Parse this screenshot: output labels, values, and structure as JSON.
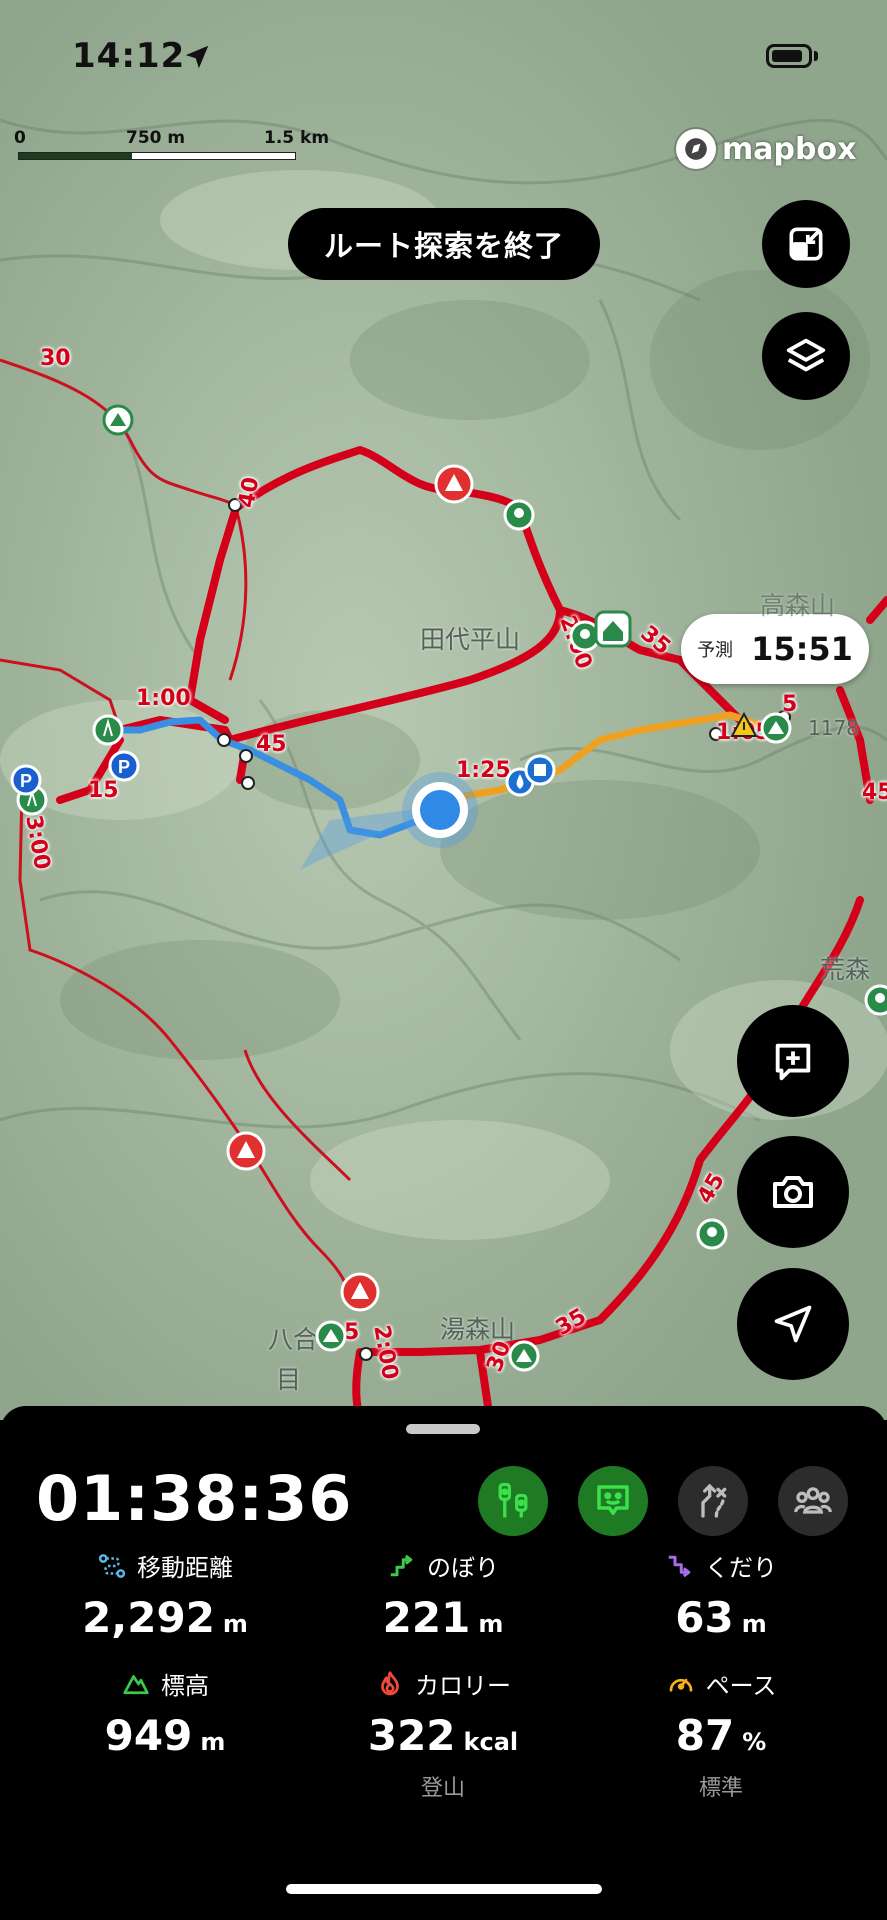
{
  "status_bar": {
    "time": "14:12"
  },
  "map": {
    "scale": {
      "zero": "0",
      "mid": "750 m",
      "max": "1.5 km"
    },
    "attribution": "mapbox",
    "end_route_search_label": "ルート探索を終了",
    "eta": {
      "label": "予測",
      "time": "15:51"
    },
    "place_names": {
      "tashiro": "田代平山",
      "yumori": "湯森山",
      "hachigo_top": "八合",
      "hachigo_bottom": "目",
      "aramori": "荒森",
      "shirouma": "高森山"
    },
    "elevation_label": "1178",
    "route_labels": [
      "30",
      "40",
      "1:00",
      "45",
      "15",
      "3:00",
      "1:25",
      "2:00",
      "35",
      "1:05",
      "5",
      "45",
      "45",
      "35",
      "30",
      "2:00",
      "5"
    ]
  },
  "panel": {
    "elapsed_time": "01:38:36",
    "stats": {
      "distance": {
        "label": "移動距離",
        "value": "2,292",
        "unit": "m"
      },
      "ascent": {
        "label": "のぼり",
        "value": "221",
        "unit": "m"
      },
      "descent": {
        "label": "くだり",
        "value": "63",
        "unit": "m"
      },
      "elevation": {
        "label": "標高",
        "value": "949",
        "unit": "m"
      },
      "calories": {
        "label": "カロリー",
        "value": "322",
        "unit": "kcal",
        "sub": "登山"
      },
      "pace": {
        "label": "ペース",
        "value": "87",
        "unit": "%",
        "sub": "標準"
      }
    }
  },
  "colors": {
    "trail_red": "#d4001a",
    "track_blue": "#3a8fe0",
    "route_orange": "#f0a020",
    "chip_green": "#1f7a24",
    "chip_gray": "#2c2c2c"
  }
}
